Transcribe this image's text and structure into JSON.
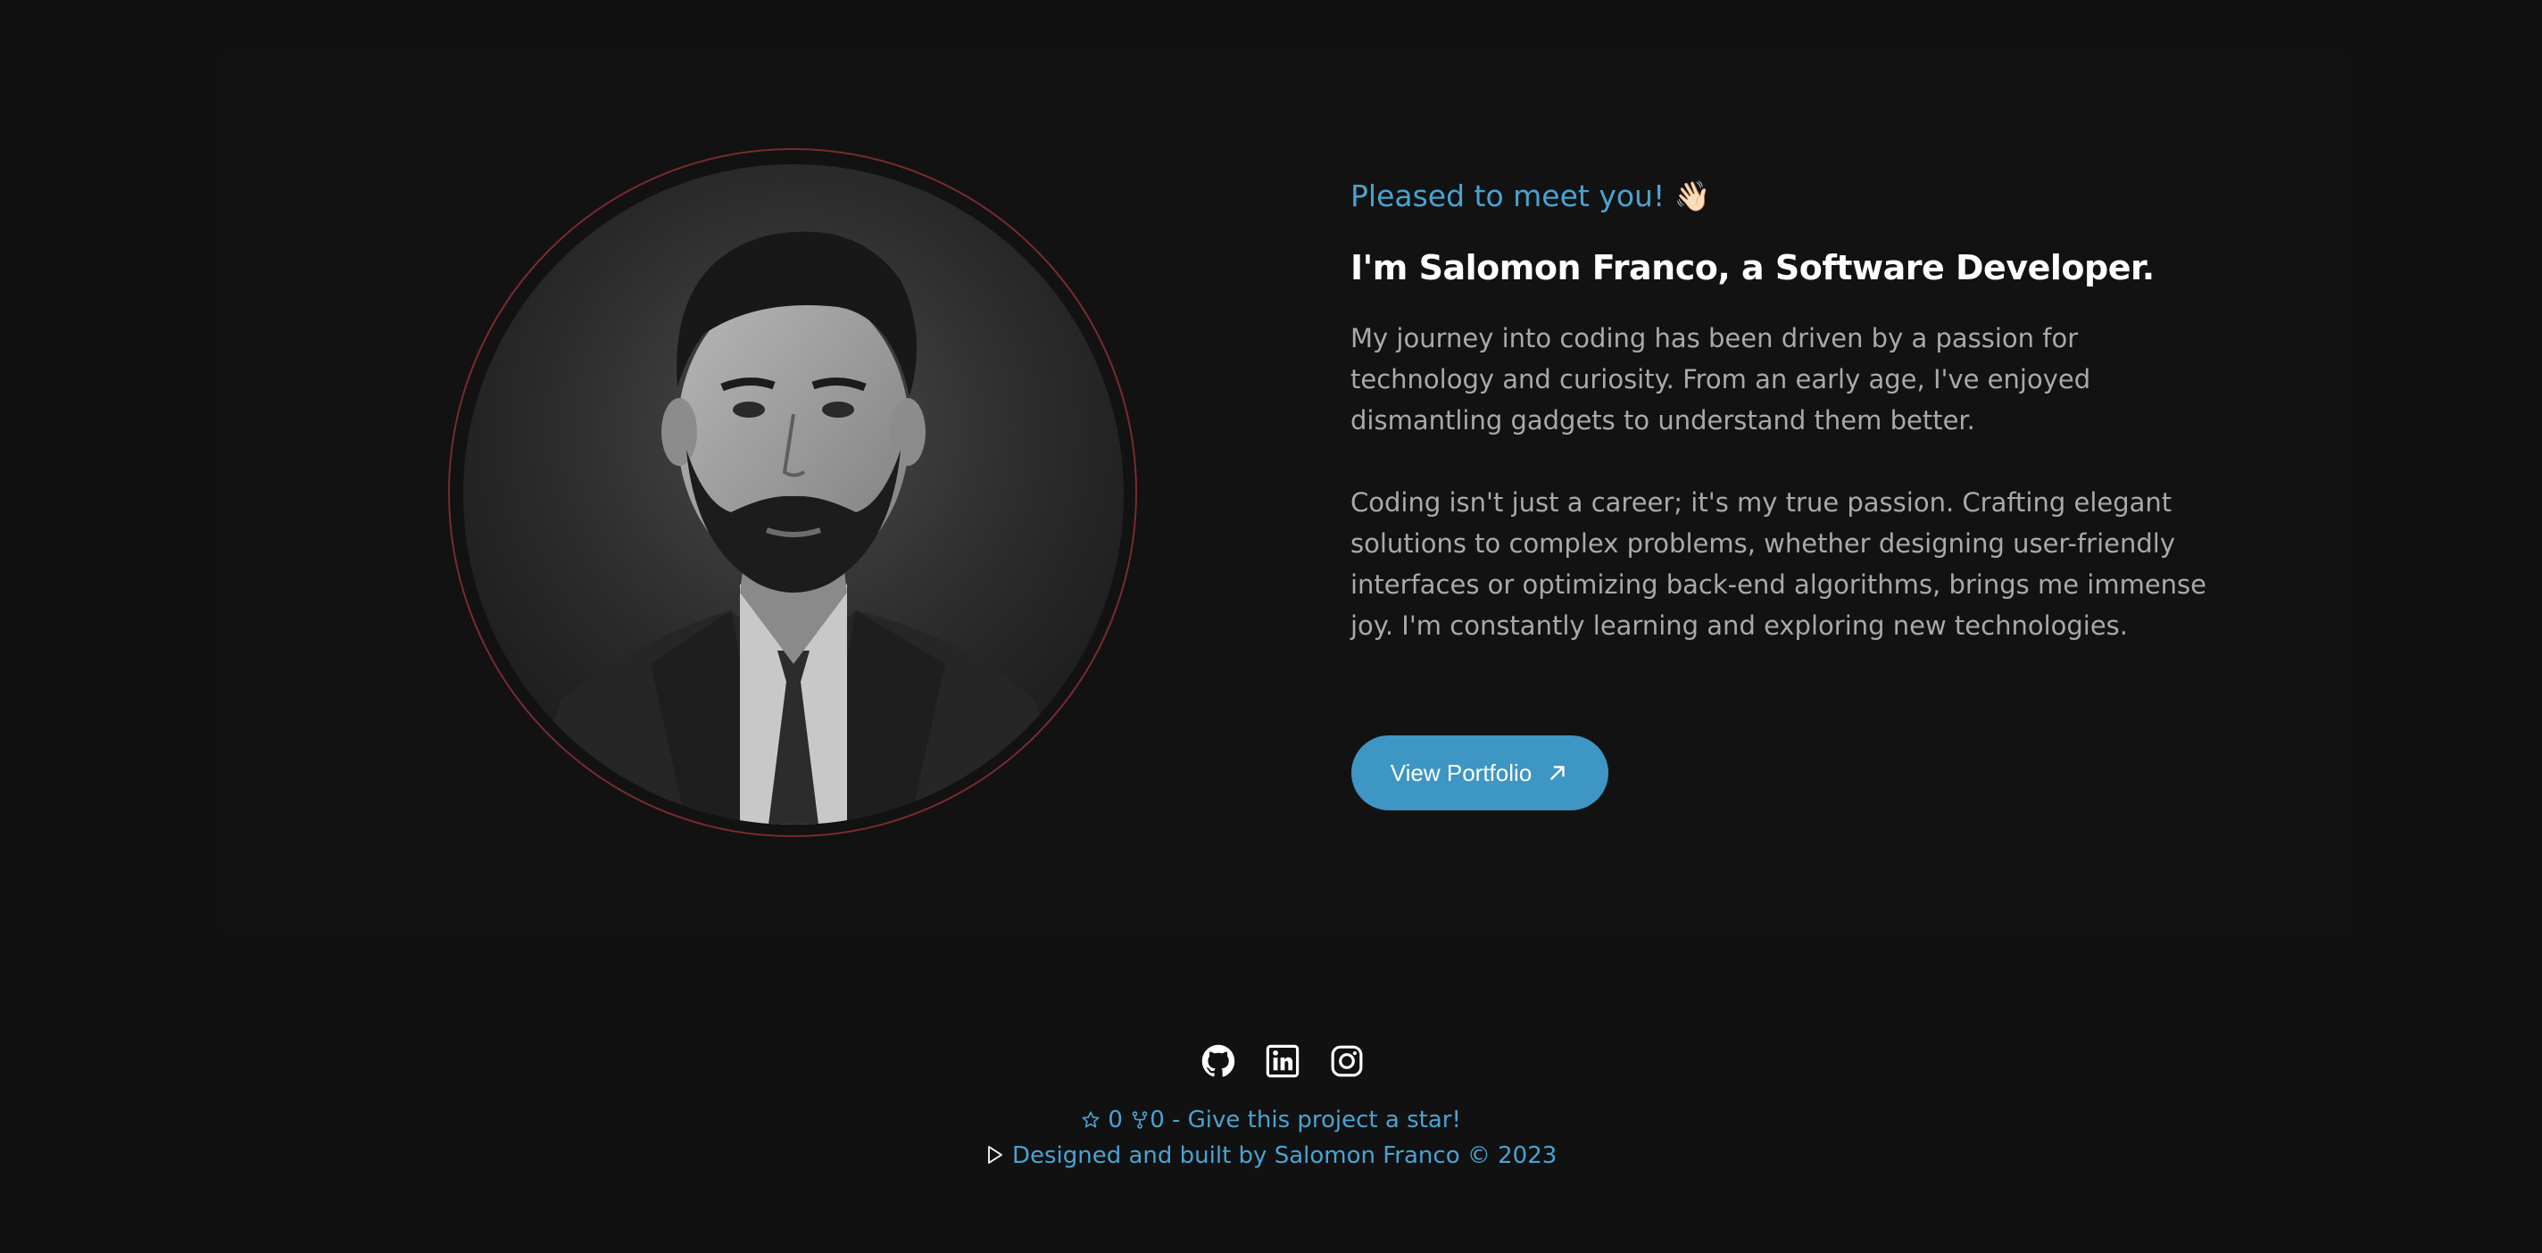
{
  "hero": {
    "greeting": "Pleased to meet you! 👋🏻",
    "headline": "I'm Salomon Franco, a Software Developer.",
    "bio_paragraph_1": "My journey into coding has been driven by a passion for technology and curiosity. From an early age, I've enjoyed dismantling gadgets to understand them better.",
    "bio_paragraph_2": "Coding isn't just a career; it's my true passion. Crafting elegant solutions to complex problems, whether designing user-friendly interfaces or optimizing back-end algorithms, brings me immense joy. I'm constantly learning and exploring new technologies.",
    "portfolio_button_label": "View Portfolio",
    "portfolio_button_icon": "arrow-up-right-icon",
    "portrait_icon": "profile-photo"
  },
  "footer": {
    "social_links": [
      {
        "icon": "github-icon"
      },
      {
        "icon": "linkedin-icon"
      },
      {
        "icon": "instagram-icon"
      }
    ],
    "star_count": "0",
    "fork_count": "0",
    "star_cta": "- Give this project a star!",
    "credit": "Designed and built by Salomon Franco © 2023"
  },
  "colors": {
    "background": "#111112",
    "accent": "#4aa3d1",
    "button": "#3d96c4",
    "ring": "#7a2a30",
    "headline": "#ffffff",
    "body_text": "#a9a9a9"
  }
}
